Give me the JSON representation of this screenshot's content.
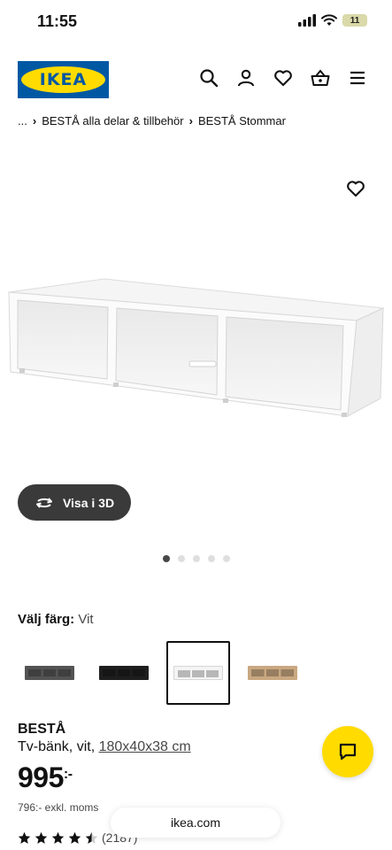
{
  "status_bar": {
    "time": "11:55",
    "battery": "11"
  },
  "header": {
    "logo_text": "IKEA",
    "icons": [
      "search-icon",
      "account-icon",
      "favorites-icon",
      "basket-icon",
      "menu-icon"
    ]
  },
  "breadcrumb": {
    "ellipsis": "...",
    "items": [
      "BESTÅ alla delar & tillbehör",
      "BESTÅ Stommar"
    ]
  },
  "gallery": {
    "view_3d_label": "Visa i 3D",
    "dots_total": 5,
    "dots_active_index": 0
  },
  "color_select": {
    "label": "Välj färg:",
    "value": "Vit",
    "swatches": [
      {
        "name": "dark-grey",
        "color": "#545454",
        "selected": false
      },
      {
        "name": "black",
        "color": "#1e1e1e",
        "selected": false
      },
      {
        "name": "white",
        "color": "#f4f4f4",
        "selected": true
      },
      {
        "name": "oak",
        "color": "#c9a881",
        "selected": false
      }
    ]
  },
  "product": {
    "name": "BESTÅ",
    "description": "Tv-bänk, vit,",
    "dimensions": "180x40x38 cm",
    "price": "995",
    "price_suffix": ":-",
    "price_excl": "796:- exkl. moms",
    "rating_stars": 4.5,
    "review_count": "(2187)"
  },
  "browser": {
    "url": "ikea.com"
  },
  "colors": {
    "brand_blue": "#0058a3",
    "brand_yellow": "#ffdb00"
  }
}
